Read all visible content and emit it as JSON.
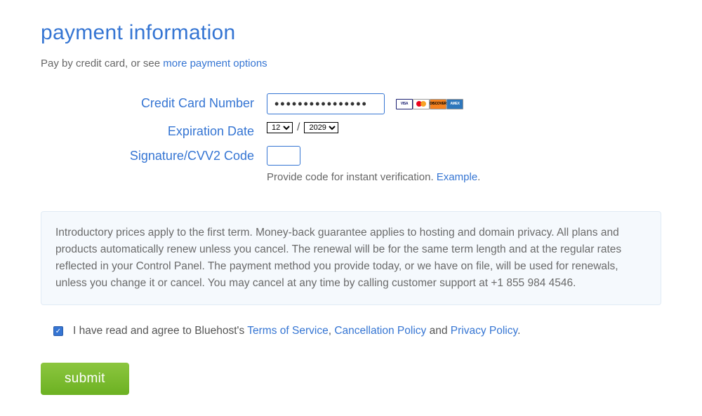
{
  "title": "payment information",
  "intro": {
    "prefix": "Pay by credit card, or see ",
    "link": "more payment options"
  },
  "form": {
    "cc_label": "Credit Card Number",
    "cc_value": "••••••••••••••••",
    "exp_label": "Expiration Date",
    "exp_month": "12",
    "exp_year": "2029",
    "exp_separator": "/",
    "cvv_label": "Signature/CVV2 Code",
    "cvv_value": "",
    "cvv_help_text": "Provide code for instant verification. ",
    "cvv_example_link": "Example",
    "cvv_help_suffix": "."
  },
  "card_icons": {
    "visa": "VISA",
    "mastercard": "",
    "discover": "DISCOVER",
    "amex": "AMEX"
  },
  "notice": "Introductory prices apply to the first term. Money-back guarantee applies to hosting and domain privacy. All plans and products automatically renew unless you cancel. The renewal will be for the same term length and at the regular rates reflected in your Control Panel. The payment method you provide today, or we have on file, will be used for renewals, unless you change it or cancel. You may cancel at any time by calling customer support at +1 855 984 4546.",
  "agree": {
    "checked": true,
    "prefix": "I have read and agree to Bluehost's ",
    "tos": "Terms of Service",
    "sep1": ", ",
    "cancel": "Cancellation Policy",
    "sep2": " and ",
    "privacy": "Privacy Policy",
    "suffix": "."
  },
  "submit_label": "submit"
}
